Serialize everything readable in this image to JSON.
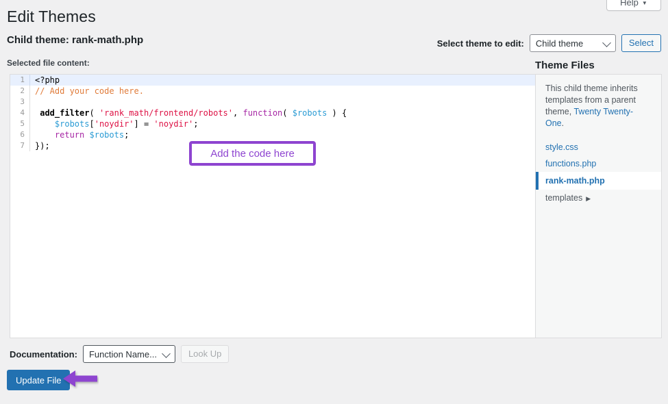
{
  "header": {
    "page_title": "Edit Themes",
    "help_label": "Help",
    "help_caret": "▼",
    "subtitle": "Child theme: rank-math.php",
    "file_content_label": "Selected file content:"
  },
  "theme_selector": {
    "label": "Select theme to edit:",
    "selected_value": "Child theme",
    "select_button": "Select",
    "chevron_icon": "chevron-down"
  },
  "theme_files": {
    "heading": "Theme Files",
    "description_part1": "This child theme inherits templates from a parent theme, ",
    "parent_theme_link": "Twenty Twenty-One",
    "description_part2": ".",
    "items": [
      {
        "label": "style.css",
        "selected": false,
        "type": "file"
      },
      {
        "label": "functions.php",
        "selected": false,
        "type": "file"
      },
      {
        "label": "rank-math.php",
        "selected": true,
        "type": "file"
      },
      {
        "label": "templates",
        "selected": false,
        "type": "folder",
        "arrow": "▶"
      }
    ]
  },
  "editor": {
    "lines": [
      {
        "number": "1",
        "active": true,
        "tokens": [
          {
            "t": "<?php",
            "c": "plain"
          }
        ]
      },
      {
        "number": "2",
        "active": false,
        "tokens": [
          {
            "t": "// Add your code here.",
            "c": "comment"
          }
        ]
      },
      {
        "number": "3",
        "active": false,
        "tokens": [
          {
            "t": "",
            "c": "plain"
          }
        ]
      },
      {
        "number": "4",
        "active": false,
        "tokens": [
          {
            "t": " ",
            "c": "plain"
          },
          {
            "t": "add_filter",
            "c": "fn"
          },
          {
            "t": "( ",
            "c": "plain"
          },
          {
            "t": "'rank_math/frontend/robots'",
            "c": "string"
          },
          {
            "t": ", ",
            "c": "plain"
          },
          {
            "t": "function",
            "c": "kw"
          },
          {
            "t": "( ",
            "c": "plain"
          },
          {
            "t": "$robots",
            "c": "var"
          },
          {
            "t": " ) {",
            "c": "plain"
          }
        ]
      },
      {
        "number": "5",
        "active": false,
        "tokens": [
          {
            "t": "    ",
            "c": "plain"
          },
          {
            "t": "$robots",
            "c": "var"
          },
          {
            "t": "[",
            "c": "plain"
          },
          {
            "t": "'noydir'",
            "c": "string"
          },
          {
            "t": "] = ",
            "c": "plain"
          },
          {
            "t": "'noydir'",
            "c": "string"
          },
          {
            "t": ";",
            "c": "plain"
          }
        ]
      },
      {
        "number": "6",
        "active": false,
        "tokens": [
          {
            "t": "    ",
            "c": "plain"
          },
          {
            "t": "return",
            "c": "kw"
          },
          {
            "t": " ",
            "c": "plain"
          },
          {
            "t": "$robots",
            "c": "var"
          },
          {
            "t": ";",
            "c": "plain"
          }
        ]
      },
      {
        "number": "7",
        "active": false,
        "tokens": [
          {
            "t": "});",
            "c": "plain"
          }
        ]
      }
    ]
  },
  "annotations": {
    "code_callout": "Add the code here",
    "callout_color": "#8e44d0",
    "arrow_color": "#8e44d0",
    "arrow_direction": "left"
  },
  "documentation": {
    "label": "Documentation:",
    "selected_value": "Function Name...",
    "lookup_button": "Look Up"
  },
  "actions": {
    "update_file": "Update File",
    "primary_color": "#2271b1"
  }
}
